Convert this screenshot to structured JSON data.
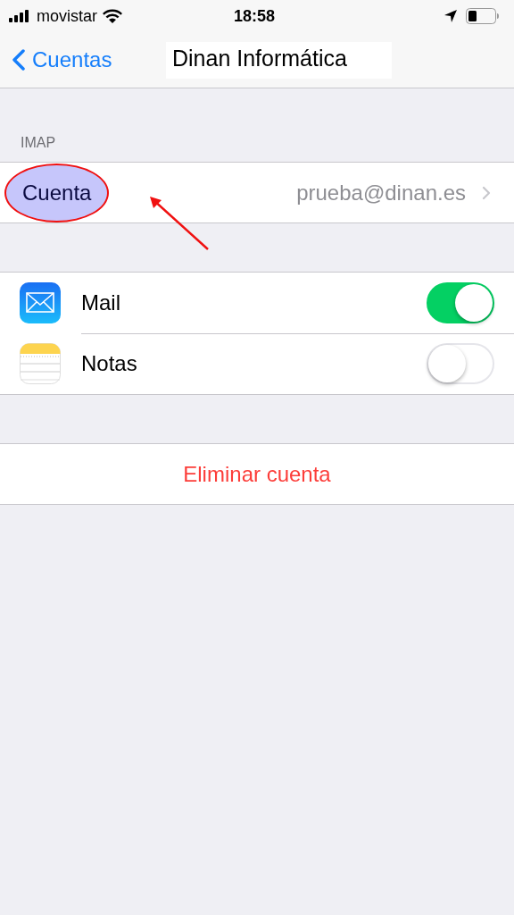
{
  "status_bar": {
    "carrier": "movistar",
    "time": "18:58"
  },
  "nav": {
    "back": "Cuentas",
    "title": "Dinan Informática"
  },
  "account_section": {
    "header": "IMAP",
    "label": "Cuenta",
    "value": "prueba@dinan.es",
    "highlighted": true
  },
  "apps": [
    {
      "kind": "mail",
      "label": "Mail",
      "on": true
    },
    {
      "kind": "notes",
      "label": "Notas",
      "on": false
    }
  ],
  "delete_button": "Eliminar cuenta"
}
